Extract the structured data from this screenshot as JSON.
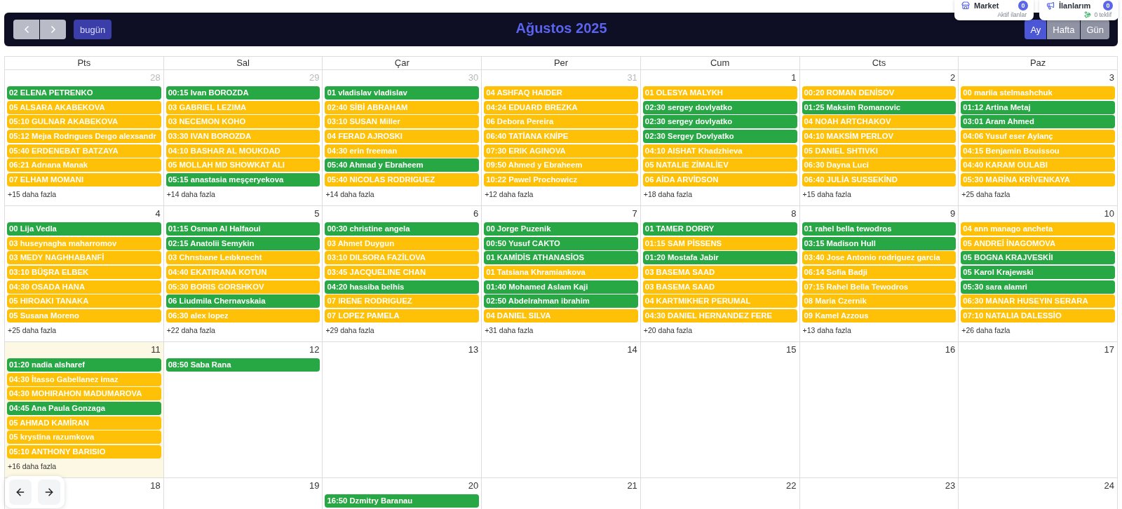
{
  "top_cards": [
    {
      "kind": "market",
      "title": "Market",
      "badge": "0",
      "subtitle": "Aktif ilanlar"
    },
    {
      "kind": "listings",
      "title": "İlanlarım",
      "badge": "0",
      "subtitle": "0 teklif"
    }
  ],
  "toolbar": {
    "today_button": "bugün",
    "title": "Ağustos 2025",
    "views": [
      {
        "label": "Ay",
        "selected": true
      },
      {
        "label": "Hafta",
        "selected": false
      },
      {
        "label": "Gün",
        "selected": false
      }
    ]
  },
  "calendar": {
    "weekdays": [
      "Pts",
      "Sal",
      "Çar",
      "Per",
      "Cum",
      "Cts",
      "Paz"
    ],
    "weeks": [
      {
        "days": [
          {
            "date": "28",
            "other_month": true,
            "today": false,
            "events": [
              {
                "text": "02 ELENA PETRENKO",
                "color": "#28a745"
              },
              {
                "text": "05 ALSARA AKABEKOVA",
                "color": "#ffc107"
              },
              {
                "text": "05:10 GULNAR AKABEKOVA",
                "color": "#ffc107"
              },
              {
                "text": "05:12 Mejıa Rodrıgues Deıgo alexsandr",
                "color": "#ffc107"
              },
              {
                "text": "05:40 ERDENEBAT BATZAYA",
                "color": "#ffc107"
              },
              {
                "text": "06:21 Adrıana Manak",
                "color": "#ffc107"
              },
              {
                "text": "07 ELHAM MOMANI",
                "color": "#ffc107"
              }
            ],
            "more": "+15 daha fazla"
          },
          {
            "date": "29",
            "other_month": true,
            "today": false,
            "events": [
              {
                "text": "00:15 Ivan BOROZDA",
                "color": "#28a745"
              },
              {
                "text": "03 GABRIEL LEZIMA",
                "color": "#ffc107"
              },
              {
                "text": "03 NECEMON KOHO",
                "color": "#ffc107"
              },
              {
                "text": "03:30 IVAN BOROZDA",
                "color": "#ffc107"
              },
              {
                "text": "04:10 BASHAR AL MOUKDAD",
                "color": "#ffc107"
              },
              {
                "text": "05 MOLLAH MD SHOWKAT ALI",
                "color": "#ffc107"
              },
              {
                "text": "05:15 anastasia meşçeryekova",
                "color": "#28a745"
              }
            ],
            "more": "+14 daha fazla"
          },
          {
            "date": "30",
            "other_month": true,
            "today": false,
            "events": [
              {
                "text": "01 vladislav vladislav",
                "color": "#28a745"
              },
              {
                "text": "02:40 SİBİ ABRAHAM",
                "color": "#ffc107"
              },
              {
                "text": "03:10 SUSAN Miller",
                "color": "#ffc107"
              },
              {
                "text": "04 FERAD AJROSKI",
                "color": "#ffc107"
              },
              {
                "text": "04:30 erin freeman",
                "color": "#ffc107"
              },
              {
                "text": "05:40 Ahmad y Ebraheem",
                "color": "#28a745"
              },
              {
                "text": "05:40 NICOLAS RODRIGUEZ",
                "color": "#ffc107"
              }
            ],
            "more": "+14 daha fazla"
          },
          {
            "date": "31",
            "other_month": true,
            "today": false,
            "events": [
              {
                "text": "04 ASHFAQ HAIDER",
                "color": "#ffc107"
              },
              {
                "text": "04:24 EDUARD BREZKA",
                "color": "#ffc107"
              },
              {
                "text": "06 Debora Pereira",
                "color": "#ffc107"
              },
              {
                "text": "06:40 TATİANA KNİPE",
                "color": "#ffc107"
              },
              {
                "text": "07:30 ERIK AGINOVA",
                "color": "#ffc107"
              },
              {
                "text": "09:50 Ahmed y Ebraheem",
                "color": "#ffc107"
              },
              {
                "text": "10:22 Pawel Prochowicz",
                "color": "#ffc107"
              }
            ],
            "more": "+12 daha fazla"
          },
          {
            "date": "1",
            "other_month": false,
            "today": false,
            "events": [
              {
                "text": "01 OLESYA MALYKH",
                "color": "#ffc107"
              },
              {
                "text": "02:30 sergey dovlyatko",
                "color": "#28a745"
              },
              {
                "text": "02:30 sergey dovlyatko",
                "color": "#28a745"
              },
              {
                "text": "02:30 Sergey Dovlyatko",
                "color": "#28a745"
              },
              {
                "text": "04:10 AISHAT Khadzhieva",
                "color": "#ffc107"
              },
              {
                "text": "05 NATALIE ZİMALİEV",
                "color": "#ffc107"
              },
              {
                "text": "06 AİDA ARVİDSON",
                "color": "#ffc107"
              }
            ],
            "more": "+18 daha fazla"
          },
          {
            "date": "2",
            "other_month": false,
            "today": false,
            "events": [
              {
                "text": "00:20 ROMAN DENİSOV",
                "color": "#ffc107"
              },
              {
                "text": "01:25 Maksim Romanovic",
                "color": "#28a745"
              },
              {
                "text": "04 NOAH ARTCHAKOV",
                "color": "#ffc107"
              },
              {
                "text": "04:10 MAKSİM PERLOV",
                "color": "#ffc107"
              },
              {
                "text": "05 DANIEL SHTIVKI",
                "color": "#ffc107"
              },
              {
                "text": "06:30 Dayna Luci",
                "color": "#ffc107"
              },
              {
                "text": "06:40 JULİA SUSSEKİND",
                "color": "#ffc107"
              }
            ],
            "more": "+15 daha fazla"
          },
          {
            "date": "3",
            "other_month": false,
            "today": false,
            "events": [
              {
                "text": "00 mariia stelmashchuk",
                "color": "#ffc107"
              },
              {
                "text": "01:12 Artina Metaj",
                "color": "#28a745"
              },
              {
                "text": "03:01 Aram Ahmed",
                "color": "#28a745"
              },
              {
                "text": "04:06 Yusuf eser Aylanç",
                "color": "#ffc107"
              },
              {
                "text": "04:15 Benjamin Bouissou",
                "color": "#ffc107"
              },
              {
                "text": "04:40 KARAM OULABI",
                "color": "#ffc107"
              },
              {
                "text": "05:30 MARİNA KRİVENKAYA",
                "color": "#ffc107"
              }
            ],
            "more": "+25 daha fazla"
          }
        ]
      },
      {
        "days": [
          {
            "date": "4",
            "other_month": false,
            "today": false,
            "events": [
              {
                "text": "00 Lija Vedla",
                "color": "#28a745"
              },
              {
                "text": "03 huseynagha maharromov",
                "color": "#ffc107"
              },
              {
                "text": "03 MEDY NAGHHABANFİ",
                "color": "#ffc107"
              },
              {
                "text": "03:10 BÜŞRA ELBEK",
                "color": "#ffc107"
              },
              {
                "text": "04:30 OSADA HANA",
                "color": "#ffc107"
              },
              {
                "text": "05 HIROAKI TANAKA",
                "color": "#ffc107"
              },
              {
                "text": "05 Susana Moreno",
                "color": "#ffc107"
              }
            ],
            "more": "+25 daha fazla"
          },
          {
            "date": "5",
            "other_month": false,
            "today": false,
            "events": [
              {
                "text": "01:15 Osman Al Halfaoui",
                "color": "#28a745"
              },
              {
                "text": "02:15 Anatolii Semykin",
                "color": "#28a745"
              },
              {
                "text": "03 Chrıstıane Leıbknecht",
                "color": "#ffc107"
              },
              {
                "text": "04:40 EKATIRANA KOTUN",
                "color": "#ffc107"
              },
              {
                "text": "05:30 BORIS GORSHKOV",
                "color": "#ffc107"
              },
              {
                "text": "06 Liudmila Chernavskaia",
                "color": "#28a745"
              },
              {
                "text": "06:30 alex lopez",
                "color": "#ffc107"
              }
            ],
            "more": "+22 daha fazla"
          },
          {
            "date": "6",
            "other_month": false,
            "today": false,
            "events": [
              {
                "text": "00:30 christine angela",
                "color": "#28a745"
              },
              {
                "text": "03 Ahmet Duygun",
                "color": "#ffc107"
              },
              {
                "text": "03:10 DILSORA FAZİLOVA",
                "color": "#ffc107"
              },
              {
                "text": "03:45 JACQUELINE CHAN",
                "color": "#ffc107"
              },
              {
                "text": "04:20 hassiba belhis",
                "color": "#28a745"
              },
              {
                "text": "07 IRENE RODRIGUEZ",
                "color": "#ffc107"
              },
              {
                "text": "07 LOPEZ PAMELA",
                "color": "#ffc107"
              }
            ],
            "more": "+29 daha fazla"
          },
          {
            "date": "7",
            "other_month": false,
            "today": false,
            "events": [
              {
                "text": "00 Jorge Puzenik",
                "color": "#28a745"
              },
              {
                "text": "00:50 Yusuf CAKTO",
                "color": "#28a745"
              },
              {
                "text": "01 KAMİDİS ATHANASİOS",
                "color": "#28a745"
              },
              {
                "text": "01 Tatsiana Khramiankova",
                "color": "#ffc107"
              },
              {
                "text": "01:40 Mohamed Aslam Kaji",
                "color": "#28a745"
              },
              {
                "text": "02:50 Abdelrahman ibrahim",
                "color": "#28a745"
              },
              {
                "text": "04 DANIEL SILVA",
                "color": "#ffc107"
              }
            ],
            "more": "+31 daha fazla"
          },
          {
            "date": "8",
            "other_month": false,
            "today": false,
            "events": [
              {
                "text": "01 TAMER DORRY",
                "color": "#28a745"
              },
              {
                "text": "01:15 SAM PİSSENS",
                "color": "#ffc107"
              },
              {
                "text": "01:20 Mostafa Jabir",
                "color": "#28a745"
              },
              {
                "text": "03 BASEMA SAAD",
                "color": "#ffc107"
              },
              {
                "text": "03 BASEMA SAAD",
                "color": "#ffc107"
              },
              {
                "text": "04 KARTMIKHER PERUMAL",
                "color": "#ffc107"
              },
              {
                "text": "04:30 DANIEL HERNANDEZ FERE",
                "color": "#ffc107"
              }
            ],
            "more": "+20 daha fazla"
          },
          {
            "date": "9",
            "other_month": false,
            "today": false,
            "events": [
              {
                "text": "01 rahel bella tewodros",
                "color": "#28a745"
              },
              {
                "text": "03:15 Madison Hull",
                "color": "#28a745"
              },
              {
                "text": "03:40 Jose Antonio rodriguez garcia",
                "color": "#ffc107"
              },
              {
                "text": "06:14 Sofia Badji",
                "color": "#ffc107"
              },
              {
                "text": "07:15 Rahel Bella Tewodros",
                "color": "#ffc107"
              },
              {
                "text": "08 Maria Czernik",
                "color": "#ffc107"
              },
              {
                "text": "09 Kamel Azzous",
                "color": "#ffc107"
              }
            ],
            "more": "+13 daha fazla"
          },
          {
            "date": "10",
            "other_month": false,
            "today": false,
            "events": [
              {
                "text": "04 ann manago ancheta",
                "color": "#ffc107"
              },
              {
                "text": "05 ANDREİ İNAGOMOVA",
                "color": "#ffc107"
              },
              {
                "text": "05 BOGNA KRAJVESKİI",
                "color": "#28a745"
              },
              {
                "text": "05 Karol Krajewski",
                "color": "#28a745"
              },
              {
                "text": "05:30 sara alamri",
                "color": "#28a745"
              },
              {
                "text": "06:30 MANAR HUSEYIN SERARA",
                "color": "#ffc107"
              },
              {
                "text": "07:10 NATALIA DALESSİO",
                "color": "#ffc107"
              }
            ],
            "more": "+26 daha fazla"
          }
        ]
      },
      {
        "days": [
          {
            "date": "11",
            "other_month": false,
            "today": true,
            "events": [
              {
                "text": "01:20 nadia alsharef",
                "color": "#28a745"
              },
              {
                "text": "04:30 İtasso Gabellanez imaz",
                "color": "#ffc107"
              },
              {
                "text": "04:30 MOHIRAHON MADUMAROVA",
                "color": "#ffc107"
              },
              {
                "text": "04:45 Ana Paula Gonzaga",
                "color": "#28a745"
              },
              {
                "text": "05 AHMAD KAMİRAN",
                "color": "#ffc107"
              },
              {
                "text": "05 krystina razumkova",
                "color": "#ffc107"
              },
              {
                "text": "05:10 ANTHONY BARISIO",
                "color": "#ffc107"
              }
            ],
            "more": "+16 daha fazla"
          },
          {
            "date": "12",
            "other_month": false,
            "today": false,
            "events": [
              {
                "text": "08:50 Saba Rana",
                "color": "#28a745"
              }
            ]
          },
          {
            "date": "13",
            "other_month": false,
            "today": false
          },
          {
            "date": "14",
            "other_month": false,
            "today": false
          },
          {
            "date": "15",
            "other_month": false,
            "today": false
          },
          {
            "date": "16",
            "other_month": false,
            "today": false
          },
          {
            "date": "17",
            "other_month": false,
            "today": false
          }
        ]
      },
      {
        "days": [
          {
            "date": "18",
            "other_month": false,
            "today": false
          },
          {
            "date": "19",
            "other_month": false,
            "today": false
          },
          {
            "date": "20",
            "other_month": false,
            "today": false,
            "events": [
              {
                "text": "16:50 Dzmitry Baranau",
                "color": "#28a745"
              }
            ]
          },
          {
            "date": "21",
            "other_month": false,
            "today": false
          },
          {
            "date": "22",
            "other_month": false,
            "today": false
          },
          {
            "date": "23",
            "other_month": false,
            "today": false
          },
          {
            "date": "24",
            "other_month": false,
            "today": false
          }
        ]
      }
    ]
  }
}
